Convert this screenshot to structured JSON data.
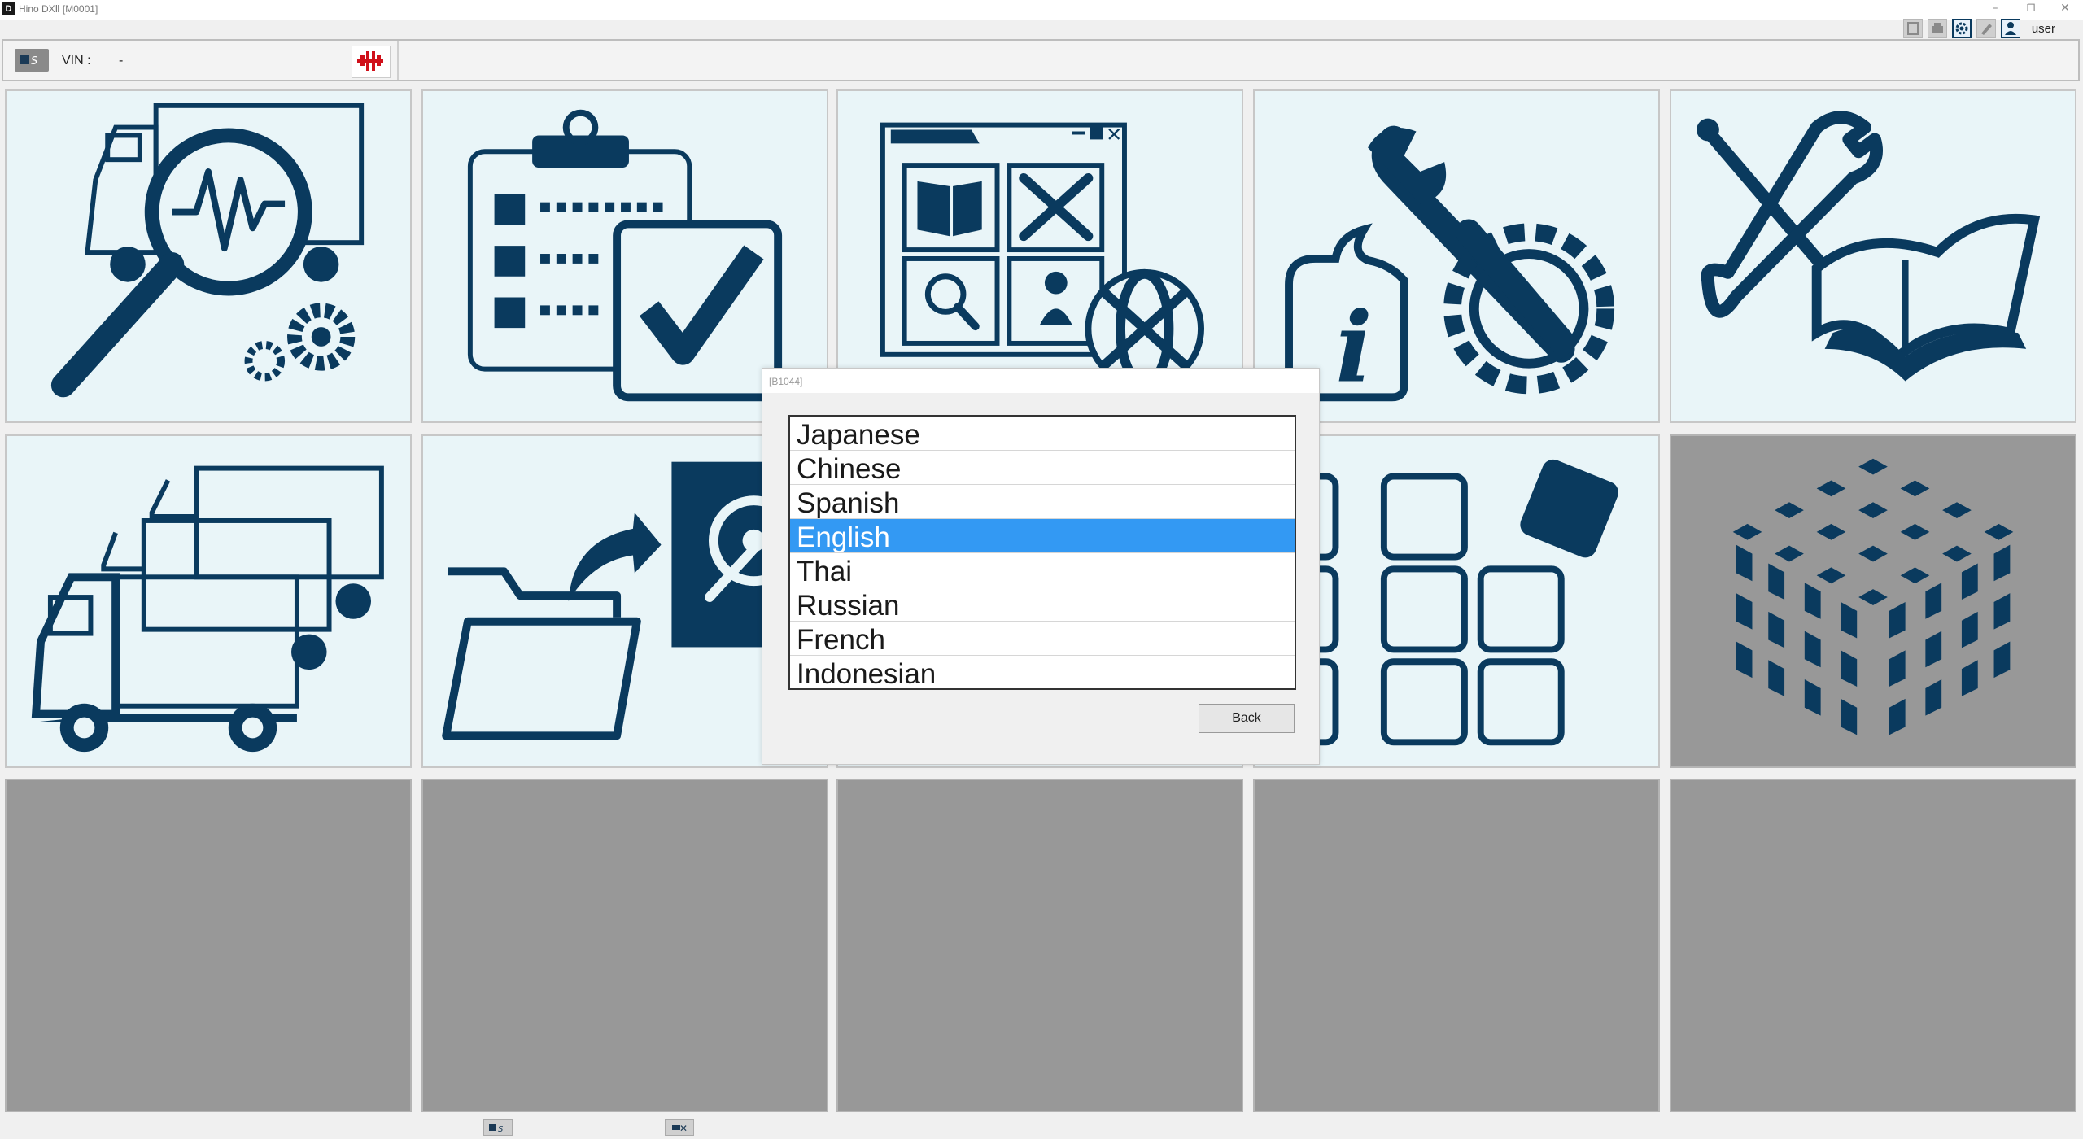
{
  "window": {
    "badge": "D",
    "title": "Hino DXⅡ [M0001]",
    "minimize": "–",
    "restore": "❐",
    "close": "✕"
  },
  "toolbar": {
    "icons": [
      "bookmark-icon",
      "print-icon",
      "settings-icon",
      "edit-icon",
      "user-icon"
    ],
    "username": "user"
  },
  "vin_bar": {
    "label": "VIN :",
    "value": "-"
  },
  "menu_tiles": [
    {
      "icon": "vehicle-diagnosis-icon",
      "enabled": true
    },
    {
      "icon": "checklist-icon",
      "enabled": true
    },
    {
      "icon": "service-manual-window-icon",
      "enabled": true
    },
    {
      "icon": "service-information-icon",
      "enabled": true
    },
    {
      "icon": "repair-manual-icon",
      "enabled": true
    },
    {
      "icon": "fleet-trucks-icon",
      "enabled": true
    },
    {
      "icon": "data-export-icon",
      "enabled": true
    },
    {
      "icon": "app-grid-icon",
      "enabled": true
    },
    {
      "icon": "cube-icon",
      "enabled": false
    },
    {
      "icon": "",
      "enabled": false
    },
    {
      "icon": "",
      "enabled": false
    },
    {
      "icon": "",
      "enabled": false
    },
    {
      "icon": "",
      "enabled": false
    },
    {
      "icon": "",
      "enabled": false
    },
    {
      "icon": "",
      "enabled": false
    }
  ],
  "language_dialog": {
    "title": "[B1044]",
    "languages": [
      "Japanese",
      "Chinese",
      "Spanish",
      "English",
      "Thai",
      "Russian",
      "French",
      "Indonesian"
    ],
    "selected": "English",
    "back_label": "Back"
  },
  "status_bar": {
    "icons": [
      "dx-logo-icon",
      "disconnect-icon"
    ]
  },
  "colors": {
    "icon_navy": "#0a3a5e",
    "tile_bg": "#e9f5f8",
    "tile_disabled": "#989898",
    "selection": "#3399f3",
    "accent_red": "#d0101a"
  }
}
